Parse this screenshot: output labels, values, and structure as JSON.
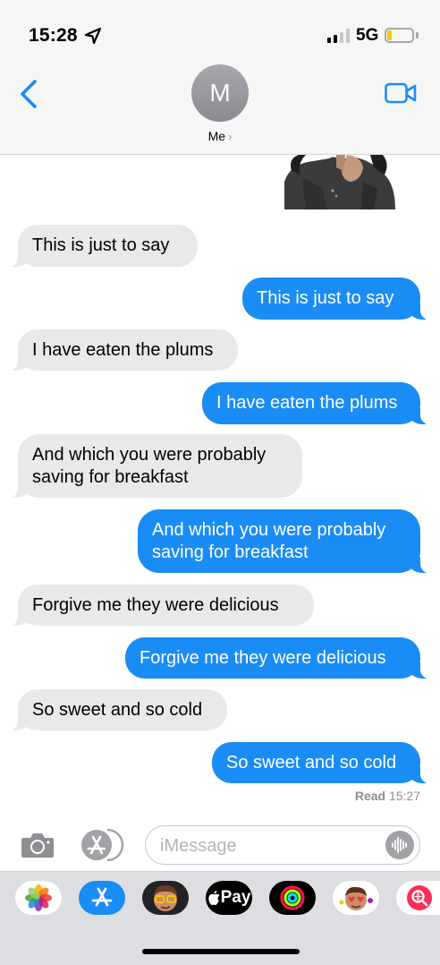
{
  "status_bar": {
    "time": "15:28",
    "network": "5G",
    "signal_bars": 2,
    "battery_level": 0.2,
    "battery_color": "#f6c700"
  },
  "header": {
    "avatar_initial": "M",
    "contact_name": "Me",
    "back_icon": "chevron-left-icon",
    "video_icon": "video-camera-icon",
    "accent_color": "#1a8cf5"
  },
  "messages": [
    {
      "direction": "in",
      "text": "This is just to say"
    },
    {
      "direction": "out",
      "text": "This is just to say"
    },
    {
      "direction": "in",
      "text": "I have eaten the plums"
    },
    {
      "direction": "out",
      "text": "I have eaten the plums"
    },
    {
      "direction": "in",
      "text": "And which you were probably saving for breakfast"
    },
    {
      "direction": "out",
      "text": "And which you were probably saving for breakfast"
    },
    {
      "direction": "in",
      "text": "Forgive me they were delicious"
    },
    {
      "direction": "out",
      "text": "Forgive me they were delicious"
    },
    {
      "direction": "in",
      "text": "So sweet and so cold"
    },
    {
      "direction": "out",
      "text": "So sweet and so cold"
    }
  ],
  "read_receipt": {
    "label": "Read",
    "time": "15:27"
  },
  "composer": {
    "placeholder": "iMessage",
    "value": ""
  },
  "app_drawer": {
    "apps": [
      "photos-icon",
      "app-store-icon",
      "memoji-icon",
      "apple-pay-icon",
      "activity-icon",
      "animoji-stickers-icon",
      "web-search-icon"
    ],
    "apple_pay_label": "Pay"
  }
}
